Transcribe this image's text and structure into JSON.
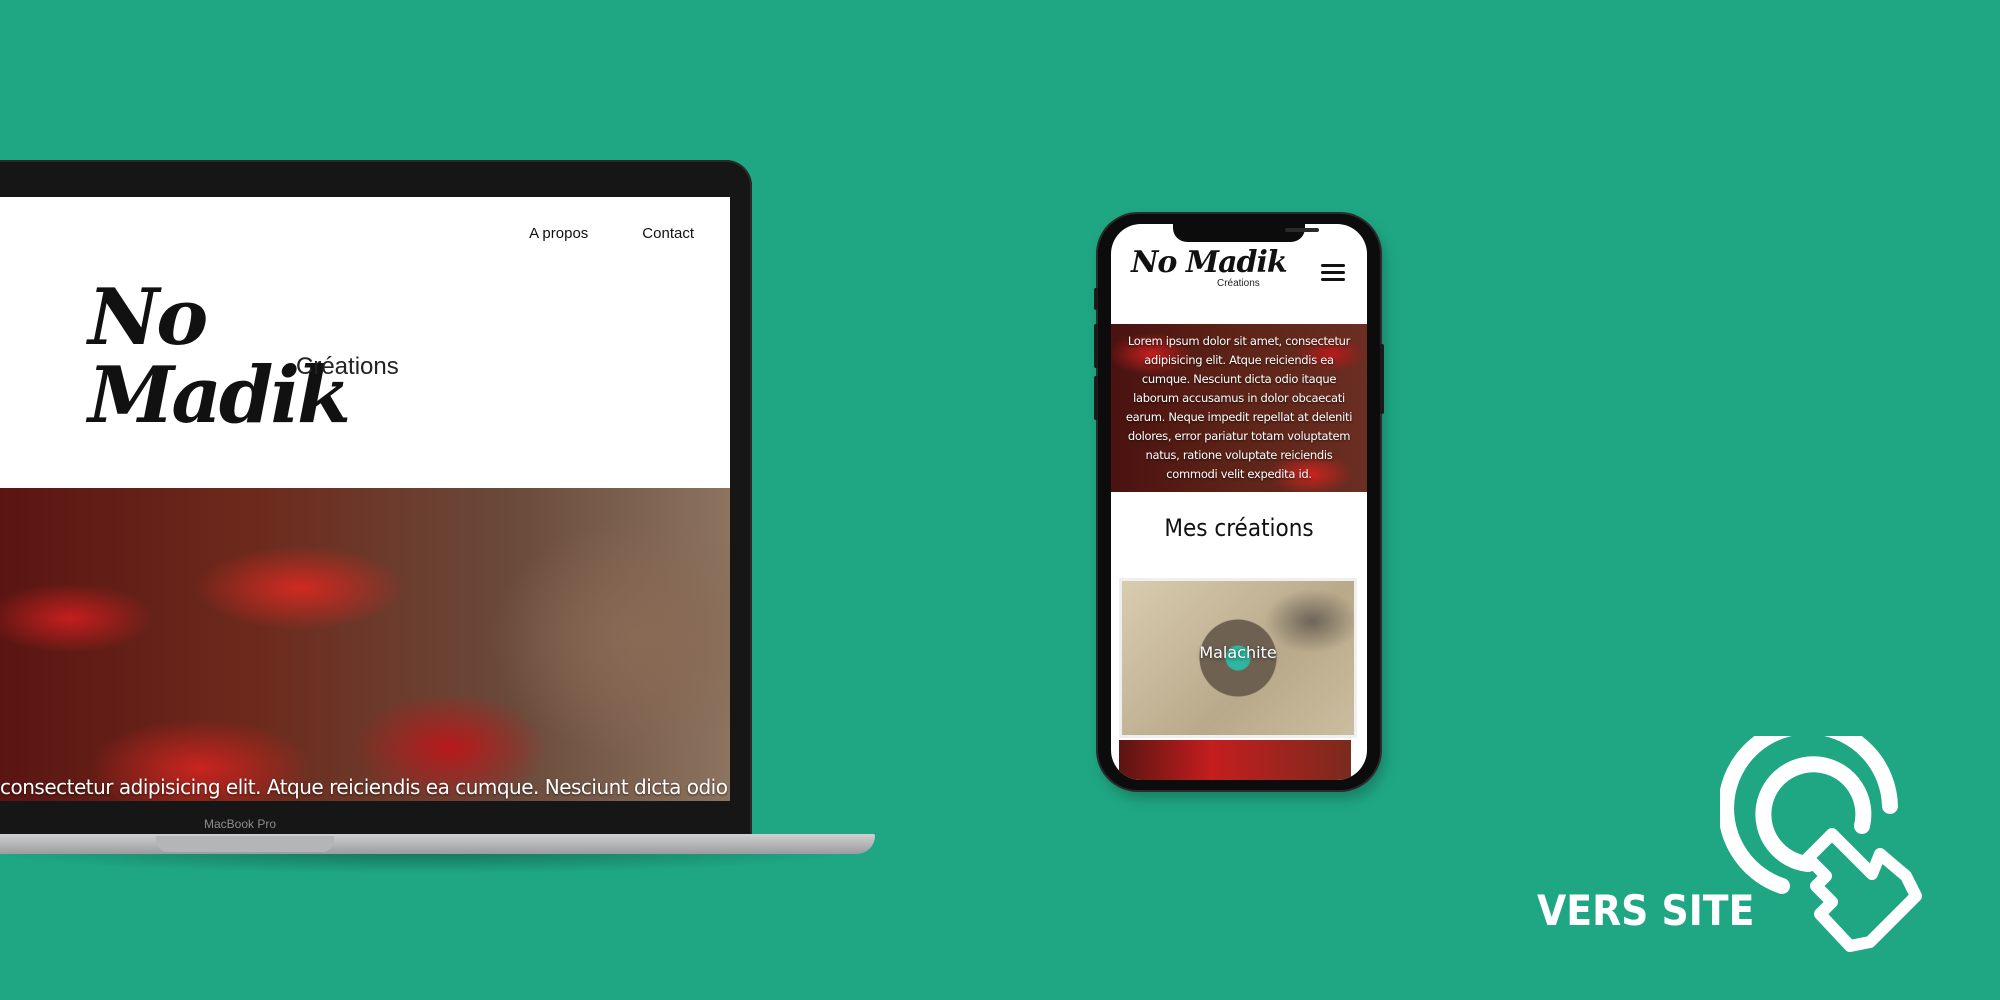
{
  "laptop": {
    "nav": {
      "about": "A propos",
      "contact": "Contact"
    },
    "logo": {
      "main": "No Madik",
      "sub": "Créations"
    },
    "hero_text": "consectetur adipisicing elit. Atque reiciendis ea cumque. Nesciunt dicta odio itaque",
    "model_label": "MacBook Pro"
  },
  "phone": {
    "logo": {
      "main": "No Madik",
      "sub": "Créations"
    },
    "hero_text": "Lorem ipsum dolor sit amet, consectetur adipisicing elit. Atque reiciendis ea cumque. Nesciunt dicta odio itaque laborum accusamus in dolor obcaecati earum. Neque impedit repellat at deleniti dolores, error pariatur totam voluptatem natus, ratione voluptate reiciendis commodi velit expedita id.",
    "section_heading": "Mes créations",
    "card_label": "Malachite"
  },
  "cta": {
    "label": "VERS SITE",
    "icon": "tap-pointer-icon"
  },
  "colors": {
    "background": "#1fa783",
    "text": "#ffffff"
  }
}
